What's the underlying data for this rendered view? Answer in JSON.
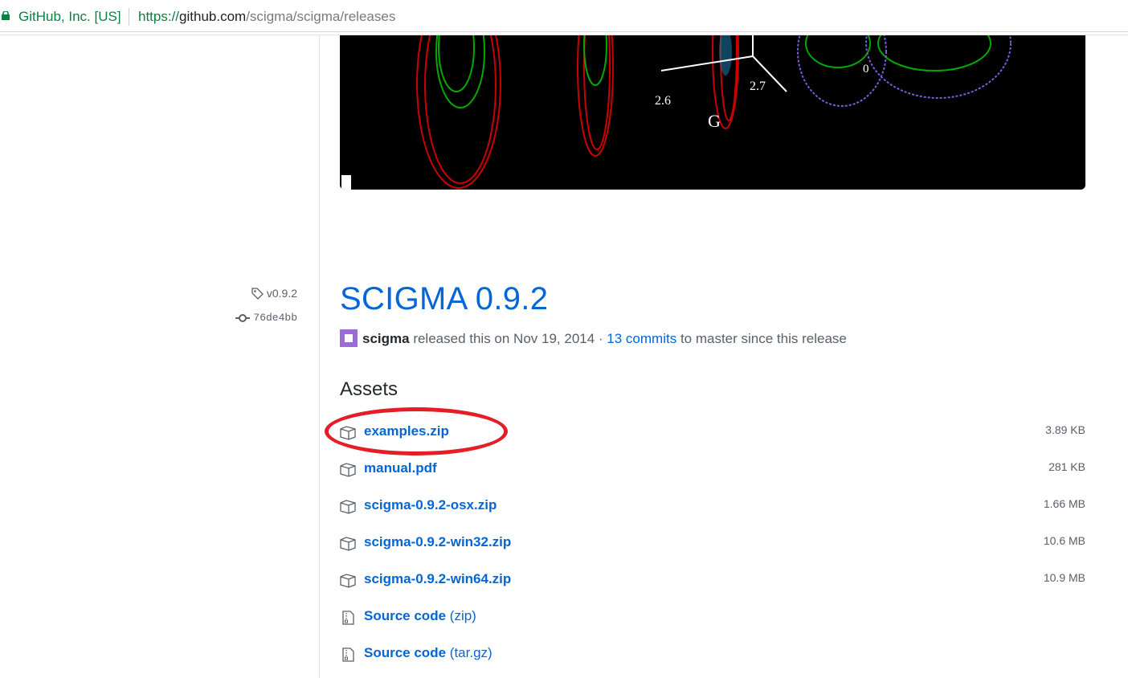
{
  "browser": {
    "site_identity": "GitHub, Inc. [US]",
    "url_scheme": "https://",
    "url_host": "github.com",
    "url_path": "/scigma/scigma/releases"
  },
  "release": {
    "tag": "v0.9.2",
    "commit": "76de4bb",
    "title": "SCIGMA 0.9.2",
    "author": "scigma",
    "released_text": " released this on Nov 19, 2014 · ",
    "commits_link": "13 commits",
    "commits_suffix": " to master since this release"
  },
  "screenshot_labels": {
    "label_a": "2.6",
    "label_b": "2.7",
    "label_c": "G",
    "label_d": "0"
  },
  "assets": {
    "heading": "Assets",
    "items": [
      {
        "name": "examples.zip",
        "size": "3.89 KB",
        "icon": "package-icon"
      },
      {
        "name": "manual.pdf",
        "size": "281 KB",
        "icon": "package-icon"
      },
      {
        "name": "scigma-0.9.2-osx.zip",
        "size": "1.66 MB",
        "icon": "package-icon"
      },
      {
        "name": "scigma-0.9.2-win32.zip",
        "size": "10.6 MB",
        "icon": "package-icon"
      },
      {
        "name": "scigma-0.9.2-win64.zip",
        "size": "10.9 MB",
        "icon": "package-icon"
      },
      {
        "name": "Source code",
        "suffix": "(zip)",
        "icon": "file-zip-icon"
      },
      {
        "name": "Source code",
        "suffix": "(tar.gz)",
        "icon": "file-zip-icon"
      }
    ]
  },
  "colors": {
    "link": "#0366d6",
    "highlight_circle": "#e41e26",
    "secure_green": "#0b8043"
  }
}
